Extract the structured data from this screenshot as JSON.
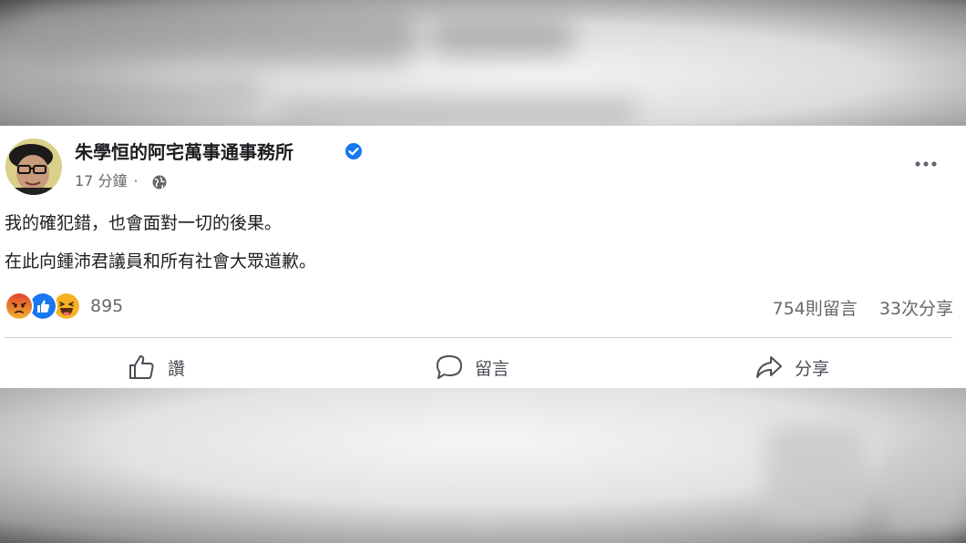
{
  "post": {
    "author": "朱學恒的阿宅萬事通事務所",
    "time": "17 分鐘",
    "separator": "·",
    "body_lines": [
      "我的確犯錯，也會面對一切的後果。",
      "在此向鍾沛君議員和所有社會大眾道歉。"
    ],
    "reactions": {
      "icons": [
        "angry-reaction-icon",
        "like-reaction-icon",
        "haha-reaction-icon"
      ],
      "count": "895"
    },
    "comments_count": "754則留言",
    "shares_count": "33次分享",
    "actions": {
      "like": "讚",
      "comment": "留言",
      "share": "分享"
    }
  },
  "colors": {
    "verified_blue": "#1877f2",
    "like_blue": "#1877f2",
    "angry_orange": "#e9710f",
    "haha_yellow": "#f7b125",
    "secondary_text": "#65676b",
    "primary_text": "#1c1e21"
  }
}
